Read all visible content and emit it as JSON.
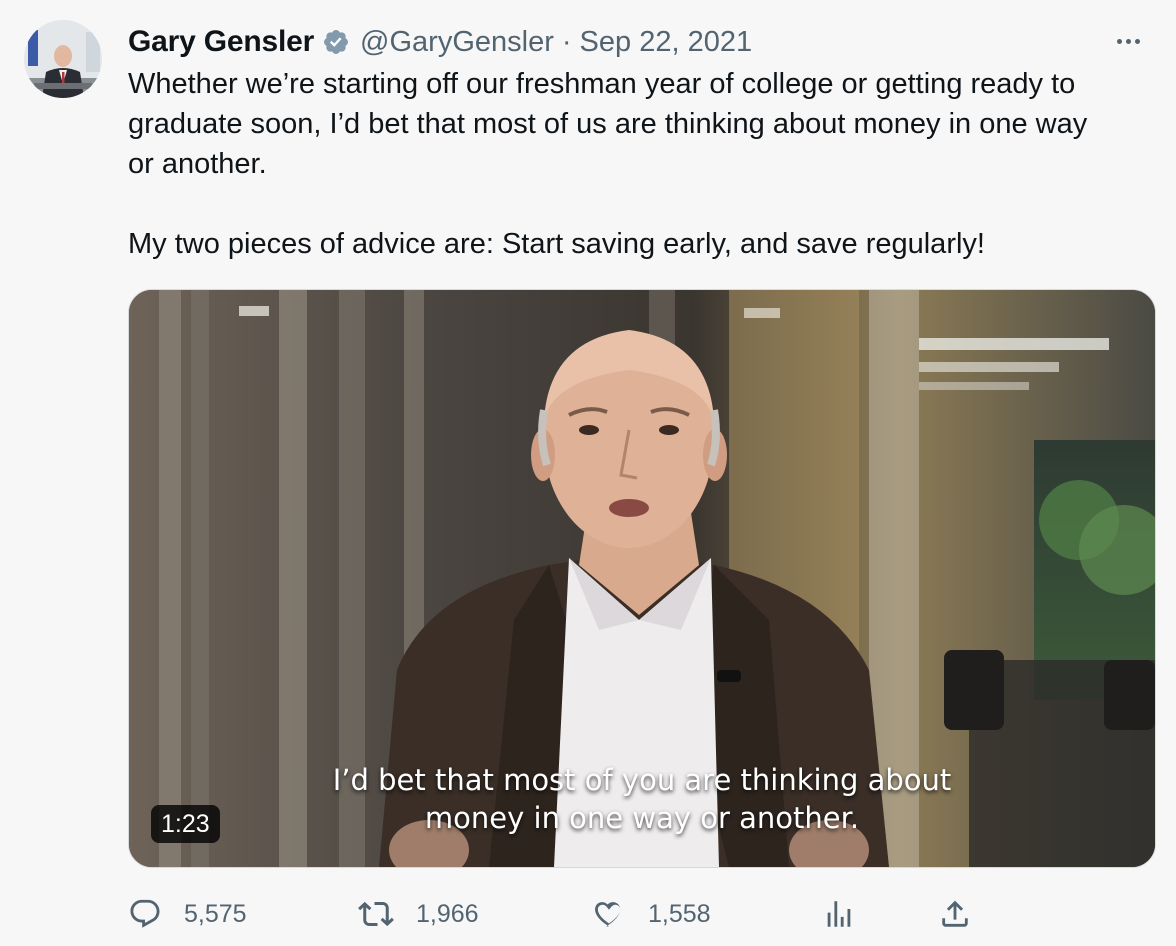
{
  "tweet": {
    "author_name": "Gary Gensler",
    "handle": "@GaryGensler",
    "separator": "·",
    "date": "Sep 22, 2021",
    "body": "Whether we’re starting off our freshman year of college or getting ready to\ngraduate soon, I’d bet that most of us are thinking about money in one way\nor another.\n\nMy two pieces of advice are: Start saving early, and save regularly!",
    "icons": {
      "verified": "verified-badge-icon",
      "more": "more-options-icon",
      "reply": "reply-icon",
      "retweet": "retweet-icon",
      "like": "like-icon",
      "views": "analytics-icon",
      "share": "share-icon"
    }
  },
  "video": {
    "caption_line1": "I’d bet that most of you are thinking about",
    "caption_line2": "money in one way or another.",
    "duration": "1:23"
  },
  "metrics": {
    "replies": "5,575",
    "retweets": "1,966",
    "likes": "1,558"
  },
  "colors": {
    "text": "#0f1419",
    "secondary": "#536471",
    "verified_badge": "#829aab",
    "background": "#f7f7f7"
  }
}
